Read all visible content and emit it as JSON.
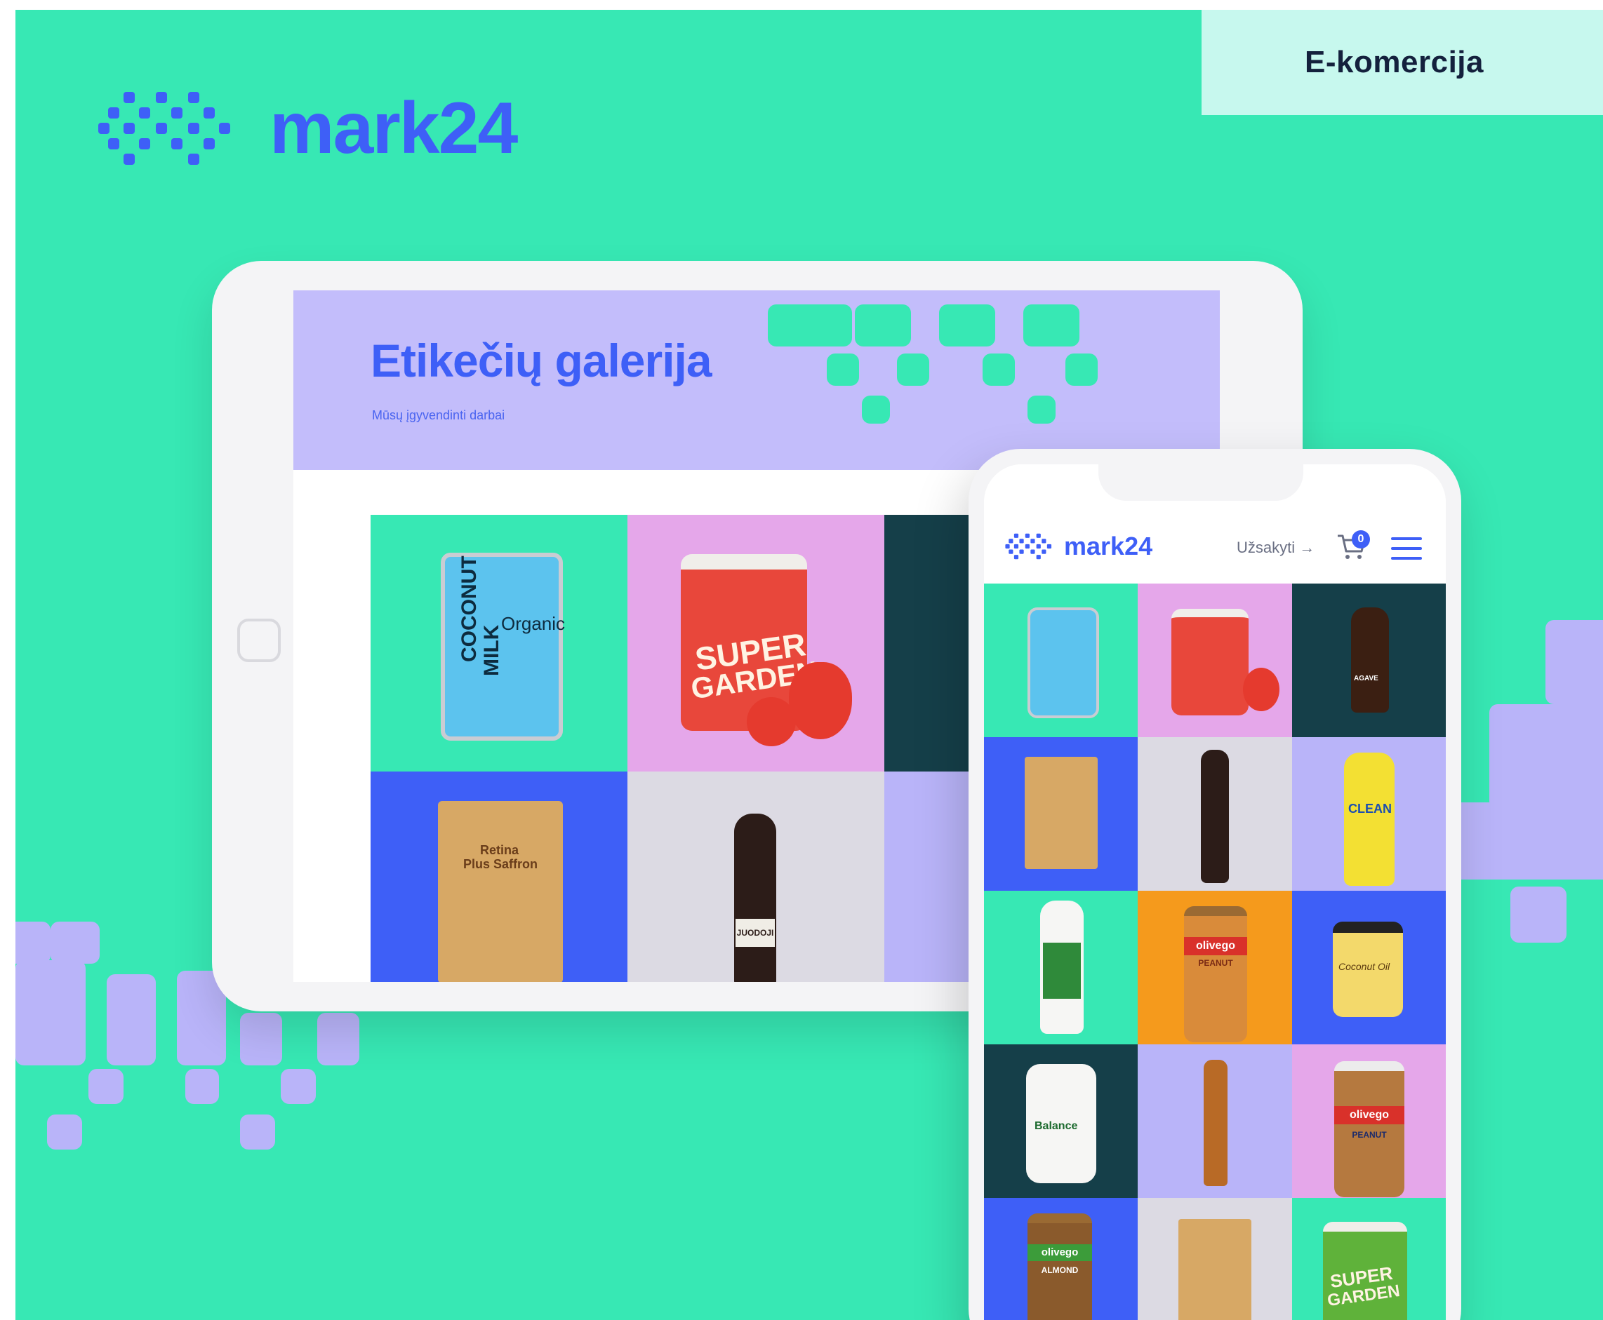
{
  "tag": {
    "label": "E-komercija"
  },
  "brand": {
    "name": "mark24"
  },
  "tablet": {
    "hero_title": "Etikečių galerija",
    "hero_subtitle": "Mūsų įgyvendinti darbai"
  },
  "phone": {
    "logo_text": "mark24",
    "order_label": "Užsakyti →",
    "cart_count": "0",
    "menu_icon": "hamburger-icon"
  },
  "products": [
    {
      "name": "coconut-milk-can",
      "label_line1": "COCONUT",
      "label_line2": "MILK",
      "label_line3": "Organic"
    },
    {
      "name": "super-garden-jar",
      "label_line1": "SUPER",
      "label_line2": "GARDEN"
    },
    {
      "name": "agave-bottle",
      "label_line1": "AGAVE"
    },
    {
      "name": "retina-saffron-pouch",
      "label_line1": "Retina",
      "label_line2": "Plus Saffron"
    },
    {
      "name": "dark-beer-bottle",
      "label_line1": "JUODOJI"
    },
    {
      "name": "clean-bottle",
      "label_line1": "CLEAN"
    },
    {
      "name": "milk-bottle"
    },
    {
      "name": "olivego-peanut-jar",
      "label_line1": "olivego",
      "label_line2": "PEANUT"
    },
    {
      "name": "coconut-oil-jar",
      "label_line1": "Coconut Oil"
    },
    {
      "name": "balance-soap",
      "label_line1": "Balance"
    },
    {
      "name": "beer-bottle"
    },
    {
      "name": "olivego-peanut-jar-2",
      "label_line1": "olivego",
      "label_line2": "PEANUT"
    },
    {
      "name": "olivego-almond-jar",
      "label_line1": "olivego",
      "label_line2": "ALMOND"
    },
    {
      "name": "pouch"
    },
    {
      "name": "super-garden-jar-2",
      "label_line1": "SUPER",
      "label_line2": "GARDEN"
    }
  ],
  "colors": {
    "background": "#37e8b4",
    "brand_blue": "#3e5ff7",
    "lavender": "#c3bdfb",
    "tag_bg": "#c7f8ee"
  }
}
